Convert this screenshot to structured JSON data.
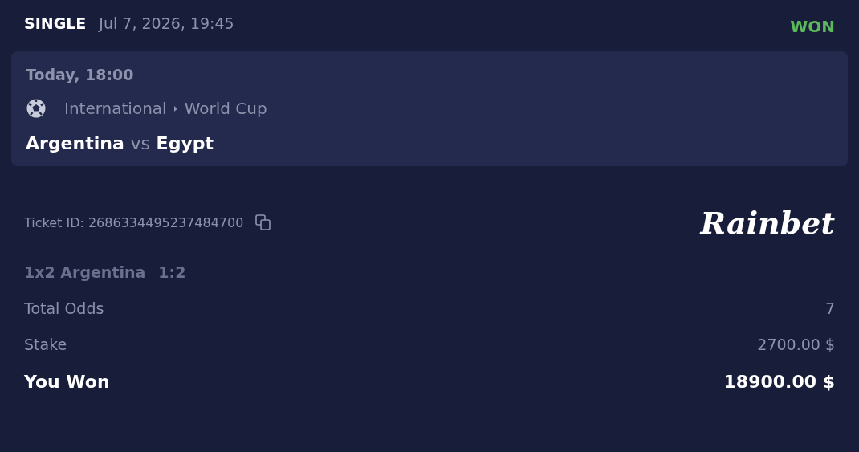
{
  "header": {
    "bet_type": "SINGLE",
    "placed_at": "Jul 7, 2026, 19:45",
    "status": {
      "label": "WON",
      "kind": "won"
    }
  },
  "event": {
    "start": "Today, 18:00",
    "kind": "football",
    "category": "International",
    "league": "World Cup",
    "home": "Argentina",
    "separator": "vs",
    "away": "Egypt"
  },
  "ticket": {
    "id_text": "Ticket ID: 2686334495237484700",
    "brand": "Rainbet"
  },
  "selection": {
    "market": "1x2 Argentina",
    "pick_odds": "1:2"
  },
  "summary": [
    {
      "label": "Total Odds",
      "value": "7",
      "kind": "plain"
    },
    {
      "label": "Stake",
      "value": "2700.00 $",
      "kind": "plain"
    },
    {
      "label": "You Won",
      "value": "18900.00 $",
      "kind": "total"
    }
  ]
}
